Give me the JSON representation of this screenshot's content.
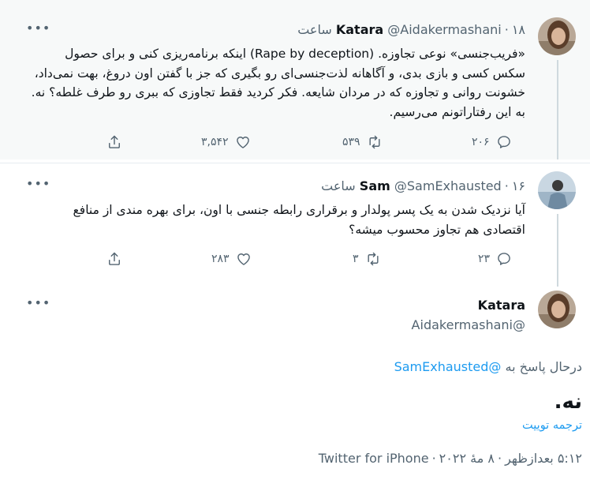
{
  "tweets": [
    {
      "name": "Katara",
      "handle": "@Aidakermashani",
      "time": "۱۸ ساعت",
      "text": "«فریب‌جنسی» نوعی تجاوزه. (Rape by deception) اینکه برنامه‌ریزی کنی و برای حصول سکس کسی و بازی بدی، و آگاهانه لذت‌جنسی‌ای رو بگیری که جز با گفتن اون دروغ، بهت نمی‌داد، خشونت روانی و تجاوزه که در مردان شایعه. فکر کردید فقط تجاوزی که ببری رو طرف غلطه؟ نه. به این رفتاراتونم می‌رسیم.",
      "replies": "۲۰۶",
      "retweets": "۵۳۹",
      "likes": "۳,۵۴۲"
    },
    {
      "name": "Sam",
      "handle": "@SamExhausted",
      "time": "۱۶ ساعت",
      "text": "آیا نزدیک شدن به یک پسر پولدار و برقراری رابطه جنسی با اون، برای بهره مندی از منافع اقتصادی هم تجاوز محسوب میشه؟",
      "replies": "۲۳",
      "retweets": "۳",
      "likes": "۲۸۳"
    }
  ],
  "main_tweet": {
    "name": "Katara",
    "handle": "@Aidakermashani",
    "replying_prefix": "درحال پاسخ به",
    "replying_mention": "@SamExhausted",
    "text": "نه.",
    "translate": "ترجمه توییت",
    "time": "۵:۱۲ بعدازظهر",
    "date": "۸ مهٔ ۲۰۲۲",
    "source": "Twitter for iPhone"
  },
  "icons": [
    "more-icon",
    "reply-icon",
    "retweet-icon",
    "like-icon",
    "share-icon"
  ],
  "colors": {
    "accent": "#1d9bf0",
    "muted": "#536471",
    "hover_bg": "#f7f9f9"
  }
}
